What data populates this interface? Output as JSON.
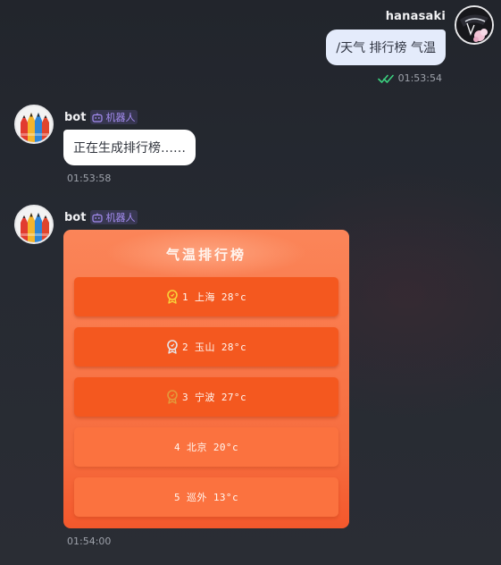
{
  "outgoing": {
    "username": "hanasaki",
    "message": "/天气 排行榜 气温",
    "time": "01:53:54",
    "read_icon": "double-check-icon",
    "read_color": "#3bd07f"
  },
  "bot": {
    "name": "bot",
    "badge_label": "机器人",
    "badge_icon": "robot-icon",
    "badge_color": "#a58df2"
  },
  "messages": [
    {
      "text": "正在生成排行榜……",
      "time": "01:53:58"
    },
    {
      "type": "image",
      "time": "01:54:00"
    }
  ],
  "ranking": {
    "title": "气温排行榜",
    "items": [
      {
        "text": "1 上海 28°c",
        "medal": "gold-medal-icon",
        "medal_color": "#f8d23a"
      },
      {
        "text": "2 玉山 28°c",
        "medal": "silver-medal-icon",
        "medal_color": "#e6e6ea"
      },
      {
        "text": "3 宁波 27°c",
        "medal": "bronze-medal-icon",
        "medal_color": "#e39a3c"
      },
      {
        "text": "4 北京 20°c"
      },
      {
        "text": "5 巡外 13°c"
      }
    ]
  },
  "colors": {
    "user_bubble": "#e4ebfb",
    "bot_bubble": "#ffffff",
    "rank_top_row": "#f4581f",
    "rank_row": "#fb723f"
  }
}
